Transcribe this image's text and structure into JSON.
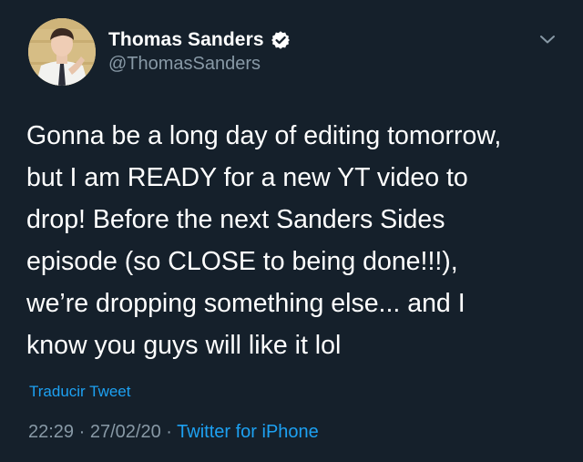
{
  "user": {
    "display_name": "Thomas Sanders",
    "handle": "@ThomasSanders",
    "verified": true
  },
  "tweet": {
    "text": "Gonna be a long day of editing tomorrow,\nbut I am READY for a new YT video to\ndrop! Before the next Sanders Sides\nepisode (so CLOSE to being done!!!),\nwe’re dropping something else... and I\nknow you guys will like it lol",
    "translate_label": "Traducir Tweet",
    "time": "22:29",
    "date": "27/02/20",
    "separator": "·",
    "source": "Twitter for iPhone"
  },
  "colors": {
    "background": "#15202b",
    "accent": "#1da1f2",
    "muted": "#8899a6",
    "text": "#ffffff"
  },
  "icons": {
    "verified": "verified-badge-icon",
    "menu": "chevron-down-icon"
  }
}
